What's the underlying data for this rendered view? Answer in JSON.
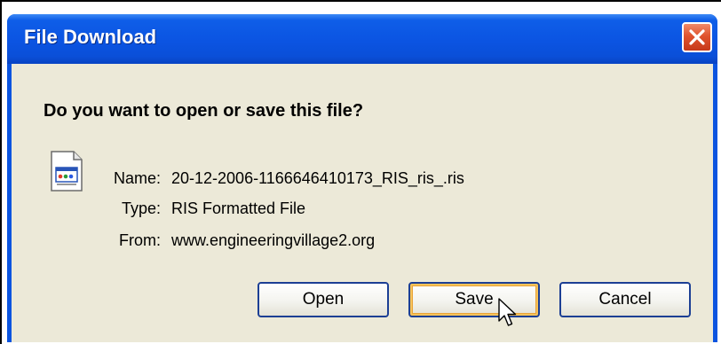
{
  "window": {
    "title": "File Download",
    "close_icon": "close-icon"
  },
  "dialog": {
    "question": "Do you want to open or save this file?",
    "file_icon": "ris-file-icon",
    "fields": {
      "name_label": "Name:",
      "name_value": "20-12-2006-1166646410173_RIS_ris_.ris",
      "type_label": "Type:",
      "type_value": "RIS Formatted File",
      "from_label": "From:",
      "from_value": "www.engineeringvillage2.org"
    },
    "buttons": {
      "open": "Open",
      "save": "Save",
      "cancel": "Cancel"
    }
  },
  "colors": {
    "titlebar": "#0a54e0",
    "client_bg": "#ece9d8",
    "close_button": "#e0532e",
    "default_button_highlight": "#f7c35a"
  }
}
